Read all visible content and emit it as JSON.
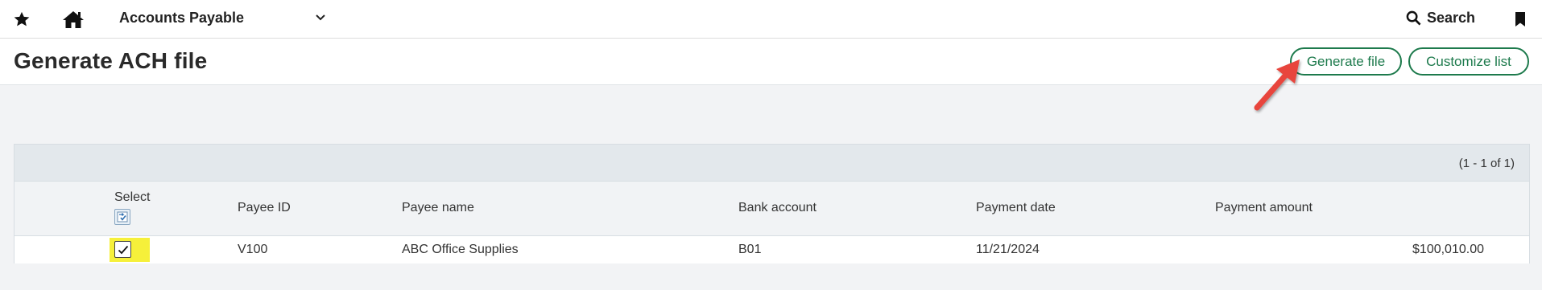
{
  "topbar": {
    "favorites_icon": "star-icon",
    "home_icon": "home-icon",
    "module_label": "Accounts Payable",
    "module_chevron_icon": "chevron-down-icon",
    "search_label": "Search",
    "search_icon": "search-icon",
    "bookmark_icon": "bookmark-icon"
  },
  "page": {
    "title": "Generate ACH file",
    "actions": {
      "generate_label": "Generate file",
      "customize_label": "Customize list"
    }
  },
  "grid": {
    "page_count": "(1 - 1 of 1)",
    "columns": {
      "select": "Select",
      "payee_id": "Payee ID",
      "payee_name": "Payee name",
      "bank_account": "Bank account",
      "payment_date": "Payment date",
      "payment_amount": "Payment amount"
    },
    "rows": [
      {
        "selected": true,
        "payee_id": "V100",
        "payee_name": "ABC Office Supplies",
        "bank_account": "B01",
        "payment_date": "11/21/2024",
        "payment_amount": "$100,010.00"
      }
    ]
  },
  "colors": {
    "accent_green": "#1d7a4c",
    "annotation_arrow": "#e8453c",
    "highlight": "#f6f03a"
  }
}
